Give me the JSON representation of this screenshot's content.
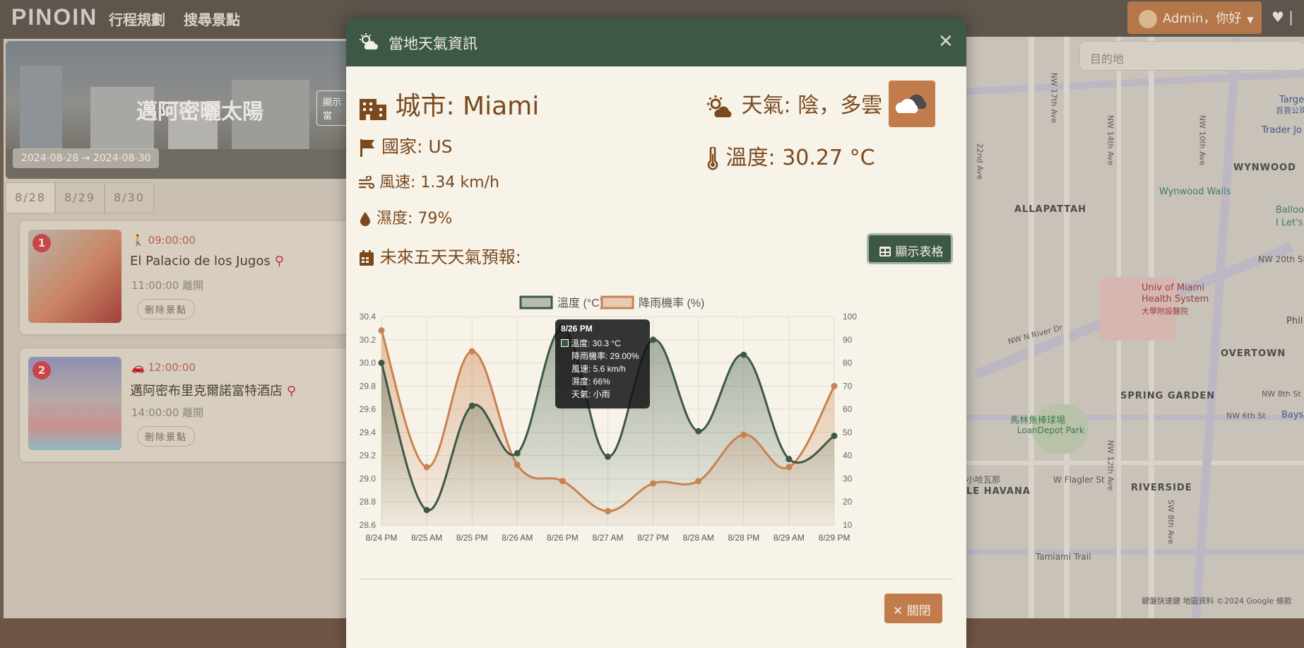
{
  "nav": {
    "brand": "PINOIN",
    "links": [
      "行程規劃",
      "搜尋景點"
    ],
    "user_label": "Admin，你好"
  },
  "trip": {
    "hero_title": "邁阿密曬太陽",
    "hero_button": "顯示當",
    "date_range": "2024-08-28 → 2024-08-30",
    "days": [
      "8/28",
      "8/29",
      "8/30"
    ],
    "stops": [
      {
        "num": "1",
        "time": "09:00:00",
        "name": "El Palacio de los Jugos",
        "leave": "11:00:00 離開",
        "delete_label": "刪除景點"
      },
      {
        "num": "2",
        "time": "12:00:00",
        "name": "邁阿密布里克爾諾富特酒店",
        "leave": "14:00:00 離開",
        "delete_label": "刪除景點"
      }
    ]
  },
  "map": {
    "search_placeholder": "目的地",
    "labels": [
      "WYNWOOD",
      "ALLAPATTAH",
      "Wynwood Walls",
      "Balloon M",
      "I Let's Fly",
      "Univ of Miami",
      "Health System",
      "大學附設醫院",
      "OVERTOWN",
      "SPRING GARDEN",
      "RIVERSIDE",
      "LE HAVANA",
      "馬林魚棒球場",
      "LoanDepot Park",
      "Trader Jo",
      "Targe",
      "百貨公司",
      "NW 20th St",
      "NW N River Dr",
      "W Flagler St",
      "Tamiami Trail",
      "NW 8th St",
      "NW 6th St",
      "Baysi",
      "Phil",
      "小哈瓦那",
      "NW 17th Ave",
      "NW 14th Ave",
      "NW 10th Ave",
      "22nd Ave",
      "NW 12th Ave",
      "SW 8th Ave"
    ],
    "credit": "鍵盤快速鍵    地圖資料 ©2024 Google    條款"
  },
  "modal": {
    "title": "當地天氣資訊",
    "city_label": "城市:",
    "city": "Miami",
    "country_label": "國家:",
    "country": "US",
    "wind_label": "風速:",
    "wind": "1.34 km/h",
    "humidity_label": "濕度:",
    "humidity": "79%",
    "weather_label": "天氣:",
    "weather": "陰，多雲",
    "temp_label": "溫度:",
    "temp": "30.27 °C",
    "forecast_title": "未來五天天氣預報:",
    "table_button": "顯示表格",
    "close_button": "關閉"
  },
  "tooltip": {
    "title": "8/26 PM",
    "lines": [
      "溫度: 30.3 °C",
      "降雨機率: 29.00%",
      "風速: 5.6 km/h",
      "濕度: 66%",
      "天氣: 小雨"
    ]
  },
  "colors": {
    "header_green": "#3d5847",
    "accent_orange": "#c27c4c",
    "text_brown": "#7a4a1e",
    "temp_series": "#3d5847",
    "rain_series": "#c9824f"
  },
  "chart_data": {
    "type": "line",
    "categories": [
      "8/24 PM",
      "8/25 AM",
      "8/25 PM",
      "8/26 AM",
      "8/26 PM",
      "8/27 AM",
      "8/27 PM",
      "8/28 AM",
      "8/28 PM",
      "8/29 AM",
      "8/29 PM"
    ],
    "series": [
      {
        "name": "溫度 (°C)",
        "axis": "left",
        "values": [
          30.0,
          28.73,
          29.63,
          29.22,
          30.3,
          29.19,
          30.2,
          29.41,
          30.07,
          29.17,
          29.37
        ]
      },
      {
        "name": "降雨機率 (%)",
        "axis": "right",
        "values": [
          94,
          35,
          85,
          36,
          29,
          16,
          28,
          29,
          49,
          35,
          70
        ]
      }
    ],
    "y_left": {
      "min": 28.6,
      "max": 30.4,
      "ticks": [
        "30.4",
        "30.2",
        "30.0",
        "29.8",
        "29.6",
        "29.4",
        "29.2",
        "29.0",
        "28.8",
        "28.6"
      ]
    },
    "y_right": {
      "min": 10,
      "max": 100,
      "ticks": [
        "100",
        "90",
        "80",
        "70",
        "60",
        "50",
        "40",
        "30",
        "20",
        "10"
      ]
    },
    "legend": "top",
    "grid": true
  }
}
